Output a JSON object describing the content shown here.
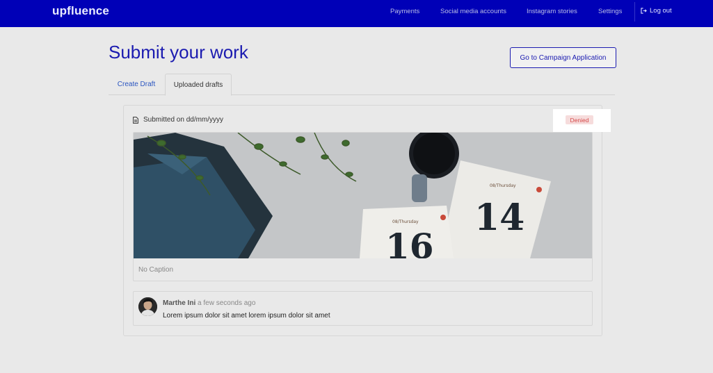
{
  "app": {
    "logo": "upfluence"
  },
  "nav": {
    "items": [
      {
        "label": "Payments"
      },
      {
        "label": "Social media accounts"
      },
      {
        "label": "Instagram stories"
      },
      {
        "label": "Settings"
      }
    ],
    "logout_label": "Log out"
  },
  "page": {
    "title": "Submit your work",
    "campaign_button": "Go to Campaign Application"
  },
  "tabs": [
    {
      "label": "Create Draft",
      "active": false
    },
    {
      "label": "Uploaded drafts",
      "active": true
    }
  ],
  "draft": {
    "submitted_text": "Submitted on dd/mm/yyyy",
    "status": "Denied",
    "caption": "No Caption",
    "photo": {
      "card_right": {
        "weekday": "08/Thursday",
        "day": "14"
      },
      "card_left": {
        "weekday": "08/Thursday",
        "day": "16"
      }
    }
  },
  "comment": {
    "author": "Marthe Ini",
    "time": "a few seconds ago",
    "text": "Lorem ipsum dolor sit amet lorem ipsum dolor sit amet"
  },
  "colors": {
    "brand": "#0000b7",
    "accent": "#1b1bb0",
    "denied_bg": "#f6dcdc",
    "denied_text": "#d64a4a"
  }
}
